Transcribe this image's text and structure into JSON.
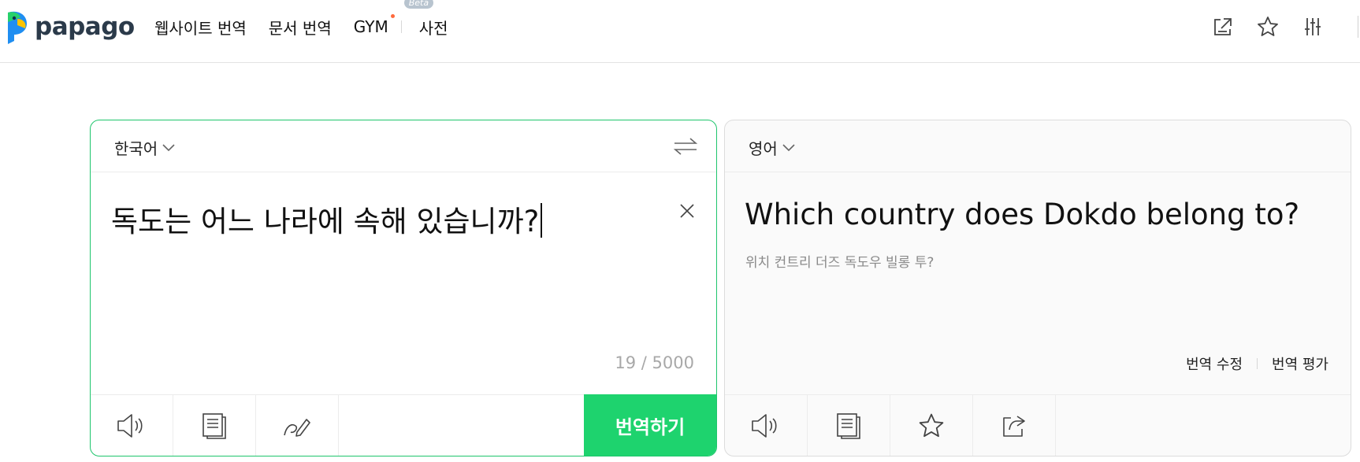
{
  "app": {
    "logo_text": "papago"
  },
  "nav": {
    "items": [
      {
        "label": "웹사이트 번역"
      },
      {
        "label": "문서 번역"
      },
      {
        "label": "GYM",
        "badge": "Beta"
      },
      {
        "label": "사전"
      }
    ]
  },
  "header_icons": [
    "open-new-window-icon",
    "star-icon",
    "settings-sliders-icon"
  ],
  "source": {
    "language": "한국어",
    "text": "독도는 어느 나라에 속해 있습니까?",
    "counter": "19 / 5000",
    "translate_button": "번역하기",
    "tools": [
      "speaker-icon",
      "copy-icon",
      "handwriting-icon"
    ]
  },
  "target": {
    "language": "영어",
    "text": "Which country does Dokdo belong to?",
    "pronunciation": "위치 컨트리 더즈 독도우 빌롱 투?",
    "edit_label": "번역 수정",
    "rate_label": "번역 평가",
    "tools": [
      "speaker-icon",
      "copy-icon",
      "star-icon",
      "share-icon"
    ]
  },
  "colors": {
    "brand_green": "#1ed36e",
    "source_border": "#1ec56c",
    "gym_dot": "#ff6a3d"
  }
}
